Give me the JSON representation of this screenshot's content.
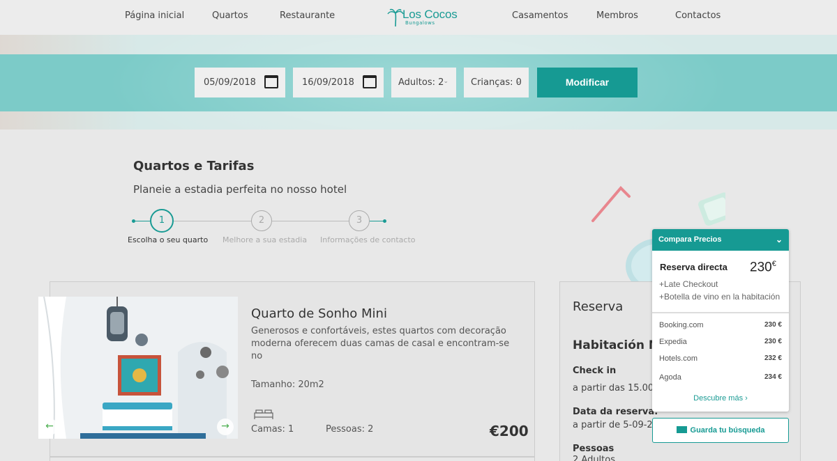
{
  "nav": {
    "home": "Página inicial",
    "rooms": "Quartos",
    "restaurant": "Restaurante",
    "logo_name": "Los Cocos",
    "logo_sub": "Bungalows",
    "weddings": "Casamentos",
    "members": "Membros",
    "contacts": "Contactos"
  },
  "search": {
    "checkin": "05/09/2018",
    "checkout": "16/09/2018",
    "adults": "Adultos: 2",
    "children": "Crianças: 0",
    "modify_label": "Modificar"
  },
  "section": {
    "title": "Quartos e Tarifas",
    "subtitle": "Planeie a estadia perfeita no nosso hotel"
  },
  "steps": [
    {
      "number": "1",
      "label": "Escolha o seu quarto"
    },
    {
      "number": "2",
      "label": "Melhore a sua estadia"
    },
    {
      "number": "3",
      "label": "Informações de contacto"
    }
  ],
  "room": {
    "title": "Quarto de Sonho Mini",
    "description": "Generosos e confortáveis, estes quartos com decoração moderna oferecem duas camas de casal e encontram-se no",
    "size": "Tamanho: 20m2",
    "beds": "Camas: 1",
    "people": "Pessoas: 2",
    "price": "€200"
  },
  "reservation": {
    "title": "Reserva",
    "room": "Habitación Mi",
    "checkin_label": "Check in",
    "checkin_value": "a partir das 15.00h",
    "date_label": "Data da reserva:",
    "date_value": "a partir de 5-09-201",
    "people_label": "Pessoas",
    "people_value": "2 Adultos"
  },
  "compare": {
    "header": "Compara Precios",
    "direct_label": "Reserva directa",
    "direct_price": "230",
    "direct_currency": "€",
    "perks": [
      "+Late Checkout",
      "+Botella de vino en la habitación"
    ],
    "offers": [
      {
        "site": "Booking.com",
        "price": "230 €"
      },
      {
        "site": "Expedia",
        "price": "230 €"
      },
      {
        "site": "Hotels.com",
        "price": "232 €"
      },
      {
        "site": "Agoda",
        "price": "234 €"
      }
    ],
    "more_label": "Descubre más",
    "save_label": "Guarda tu búsqueda"
  },
  "colors": {
    "accent": "#169a93",
    "hero_band": "#7ccbc8",
    "background": "#e8e8e8"
  },
  "icons": [
    "calendar-icon",
    "chevron-down-icon",
    "bed-icon",
    "arrow-left-icon",
    "arrow-right-icon",
    "mail-icon",
    "palm-tree-icon"
  ]
}
